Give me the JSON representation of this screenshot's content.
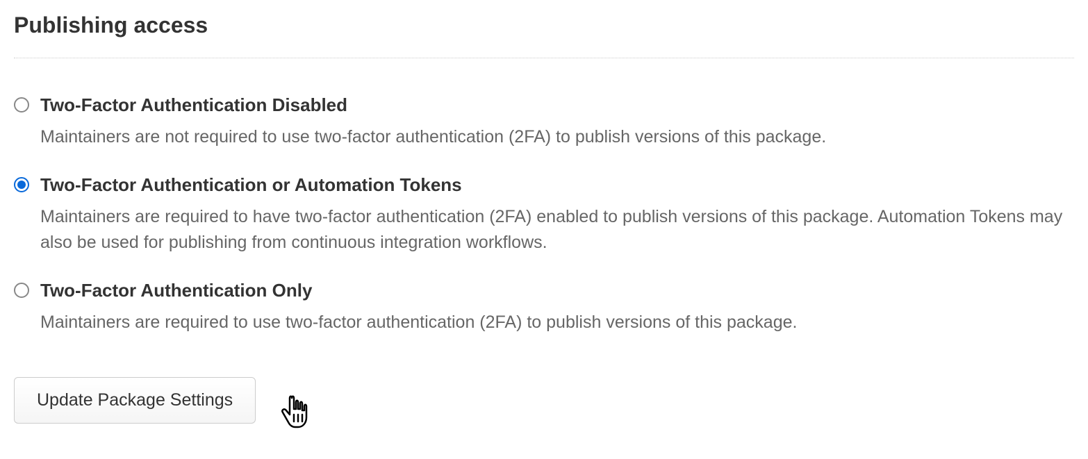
{
  "section": {
    "title": "Publishing access"
  },
  "options": [
    {
      "id": "tfa-disabled",
      "label": "Two-Factor Authentication Disabled",
      "description": "Maintainers are not required to use two-factor authentication (2FA) to publish versions of this package.",
      "checked": false
    },
    {
      "id": "tfa-or-automation",
      "label": "Two-Factor Authentication or Automation Tokens",
      "description": "Maintainers are required to have two-factor authentication (2FA) enabled to publish versions of this package. Automation Tokens may also be used for publishing from continuous integration workflows.",
      "checked": true
    },
    {
      "id": "tfa-only",
      "label": "Two-Factor Authentication Only",
      "description": "Maintainers are required to use two-factor authentication (2FA) to publish versions of this package.",
      "checked": false
    }
  ],
  "actions": {
    "update_label": "Update Package Settings"
  }
}
